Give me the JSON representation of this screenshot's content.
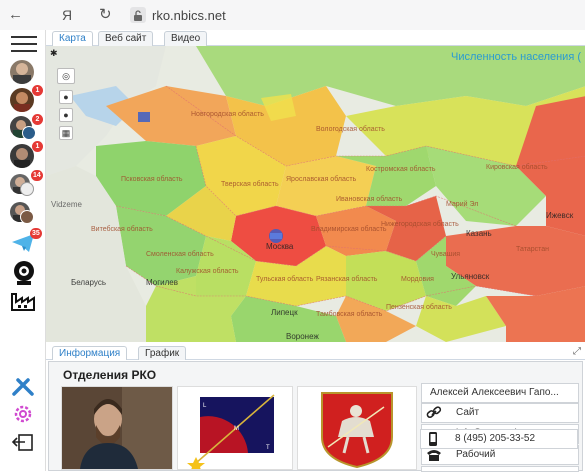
{
  "browser": {
    "back_glyph": "←",
    "yandex_label": "Я",
    "reload_glyph": "↻",
    "url": "rko.nbics.net"
  },
  "sidebar": {
    "badges": [
      "1",
      "2",
      "1",
      "14",
      "35"
    ]
  },
  "tabs": [
    "Карта",
    "Веб сайт",
    "Видео"
  ],
  "map": {
    "title": "Численность населения (",
    "labels": {
      "belarus": "Беларусь",
      "mogilev": "Могилев",
      "kazan": "Казань",
      "ulyanovsk": "Ульяновск",
      "lipetsk": "Липецк",
      "voronezh": "Воронеж",
      "izhevsk": "Ижевск",
      "vidzeme": "Vidzeme",
      "novgorod": "Новгородская область",
      "vologda": "Вологодская область",
      "pskov": "Псковская область",
      "tver": "Тверская область",
      "yaroslavl": "Ярославская область",
      "kostroma": "Костромская область",
      "kirov": "Кировская область",
      "smolensk": "Смоленская область",
      "moscow": "Москва",
      "vladimir": "Владимирская область",
      "nizhny": "Нижегородская область",
      "ryazan": "Рязанская область",
      "tula": "Тульская область",
      "tambov": "Тамбовская область",
      "penza": "Пензенская область",
      "mordovia": "Мордовия",
      "chuvash": "Чувашия",
      "tatarstan": "Татарстан",
      "ivanovo": "Ивановская область",
      "kaluga": "Калужская область",
      "vitebsk": "Витебская область",
      "mariy": "Марий Эл"
    }
  },
  "info": {
    "tabs": [
      "Информация",
      "График"
    ],
    "title": "Отделения РКО",
    "person_name": "Алексей Алексеевич Гапо...",
    "contacts": [
      {
        "icon": "link-icon",
        "text": "Сайт"
      },
      {
        "icon": "mail-icon",
        "text": "info@cosmatica.org"
      },
      {
        "icon": "phone-icon",
        "text": "Рабочий"
      },
      {
        "icon": "mobile-icon",
        "text": "8 (495) 205-33-52"
      }
    ],
    "diagram_labels": {
      "l": "L",
      "m": "M",
      "t": "T"
    }
  },
  "colors": {
    "accent": "#2f80c8",
    "map_title": "#2a9bd1",
    "badge": "#e53935"
  }
}
